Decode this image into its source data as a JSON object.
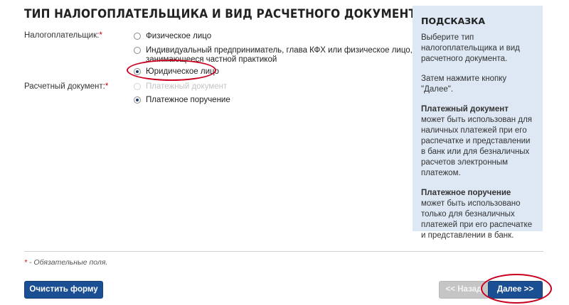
{
  "page": {
    "title": "ТИП НАЛОГОПЛАТЕЛЬЩИКА И ВИД РАСЧЕТНОГО ДОКУМЕНТА"
  },
  "taxpayer": {
    "label": "Налогоплательщик:",
    "required_mark": "*",
    "options": [
      {
        "label": "Физическое лицо",
        "checked": false
      },
      {
        "label_line1": "Индивидуальный предприниматель, глава КФХ или физическое лицо,",
        "label_line2": "занимающееся частной практикой",
        "checked": false
      },
      {
        "label": "Юридическое лицо",
        "checked": true
      }
    ]
  },
  "document": {
    "label": "Расчетный документ:",
    "required_mark": "*",
    "options": [
      {
        "label": "Платежный документ",
        "checked": false,
        "disabled": true
      },
      {
        "label": "Платежное поручение",
        "checked": true,
        "disabled": false
      }
    ]
  },
  "hint": {
    "title": "ПОДСКАЗКА",
    "p1": "Выберите тип налогоплательщика и вид расчетного документа.",
    "p2": "Затем нажмите кнопку \"Далее\".",
    "p3_bold": "Платежный документ",
    "p3_rest": " может быть использован для наличных платежей при его распечатке и представлении в банк или для безналичных расчетов электронным платежом.",
    "p4_bold": "Платежное поручение",
    "p4_rest": " может быть использовано только для безналичных платежей при его распечатке и представлении в банк."
  },
  "footer": {
    "required_mark": "*",
    "required_note": " - Обязательные поля.",
    "clear_label": "Очистить форму",
    "back_label": "<< Назад",
    "next_label": "Далее >>"
  },
  "colors": {
    "accent": "#1b4f94",
    "highlight": "#c8001e",
    "hint_background": "#dde8f4",
    "required": "#cc0000"
  }
}
